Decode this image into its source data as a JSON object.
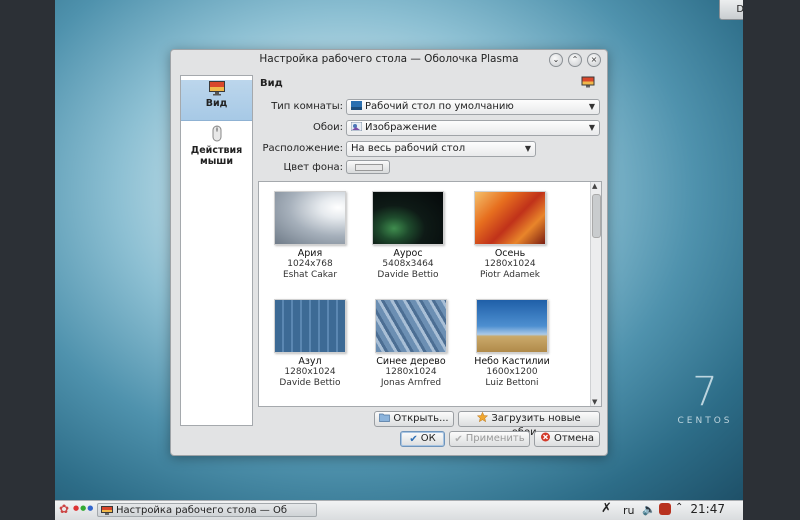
{
  "desktop": {
    "tab_label": "Desktop",
    "logo_number": "7",
    "logo_text": "CENTOS"
  },
  "window": {
    "title": "Настройка рабочего стола — Оболочка Plasma",
    "sidebar": [
      {
        "label": "Вид",
        "icon": "monitor-icon"
      },
      {
        "label_line1": "Действия",
        "label_line2": "мыши",
        "icon": "mouse-icon"
      }
    ],
    "section_title": "Вид",
    "room_type": {
      "label": "Тип комнаты:",
      "value": "Рабочий стол по умолчанию"
    },
    "wallpaper": {
      "label": "Обои:",
      "value": "Изображение"
    },
    "positioning": {
      "label": "Расположение:",
      "value": "На весь рабочий стол"
    },
    "bg_color": {
      "label": "Цвет фона:"
    },
    "wallpapers": [
      {
        "name": "Ария",
        "size": "1024x768",
        "author": "Eshat Cakar"
      },
      {
        "name": "Аурос",
        "size": "5408x3464",
        "author": "Davide Bettio"
      },
      {
        "name": "Осень",
        "size": "1280x1024",
        "author": "Piotr Adamek"
      },
      {
        "name": "Азул",
        "size": "1280x1024",
        "author": "Davide Bettio"
      },
      {
        "name": "Синее дерево",
        "size": "1280x1024",
        "author": "Jonas Arnfred"
      },
      {
        "name": "Небо Кастилии",
        "size": "1600x1200",
        "author": "Luiz Bettoni"
      }
    ],
    "buttons": {
      "open": "Открыть...",
      "download": "Загрузить новые обои...",
      "ok": "ОК",
      "apply": "Применить",
      "cancel": "Отмена"
    }
  },
  "taskbar": {
    "task_label": "Настройка рабочего стола — Об",
    "keyboard_layout": "ru",
    "clock": "21:47"
  }
}
